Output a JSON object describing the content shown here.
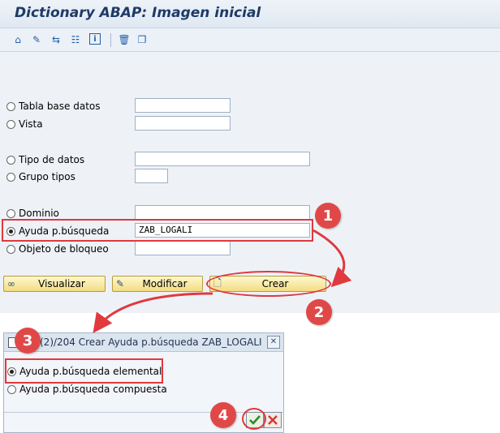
{
  "window": {
    "title": "Dictionary ABAP: Imagen inicial"
  },
  "toolbar": {
    "icons": [
      "where-used-icon",
      "edit-icon",
      "activate-icon",
      "hierarchy-icon",
      "info-icon",
      "delete-icon",
      "copy-icon"
    ]
  },
  "objects": [
    {
      "label": "Tabla base datos",
      "value": "",
      "selected": false
    },
    {
      "label": "Vista",
      "value": "",
      "selected": false
    },
    {
      "label": "Tipo de datos",
      "value": "",
      "selected": false
    },
    {
      "label": "Grupo tipos",
      "value": "",
      "selected": false
    },
    {
      "label": "Dominio",
      "value": "",
      "selected": false
    },
    {
      "label": "Ayuda p.búsqueda",
      "value": "ZAB_LOGALI",
      "selected": true
    },
    {
      "label": "Objeto de bloqueo",
      "value": "",
      "selected": false
    }
  ],
  "buttons": {
    "display": "Visualizar",
    "modify": "Modificar",
    "create": "Crear"
  },
  "dialog": {
    "title": "(2)/204 Crear Ayuda p.búsqueda ZAB_LOGALI",
    "options": [
      {
        "label": "Ayuda p.búsqueda elemental",
        "selected": true
      },
      {
        "label": "Ayuda p.búsqueda compuesta",
        "selected": false
      }
    ]
  },
  "annotations": {
    "steps": [
      "1",
      "2",
      "3",
      "4"
    ],
    "color": "#e04848"
  },
  "colors": {
    "accent": "#e0393e",
    "button": "#f4dc83",
    "title": "#1e3a66"
  }
}
